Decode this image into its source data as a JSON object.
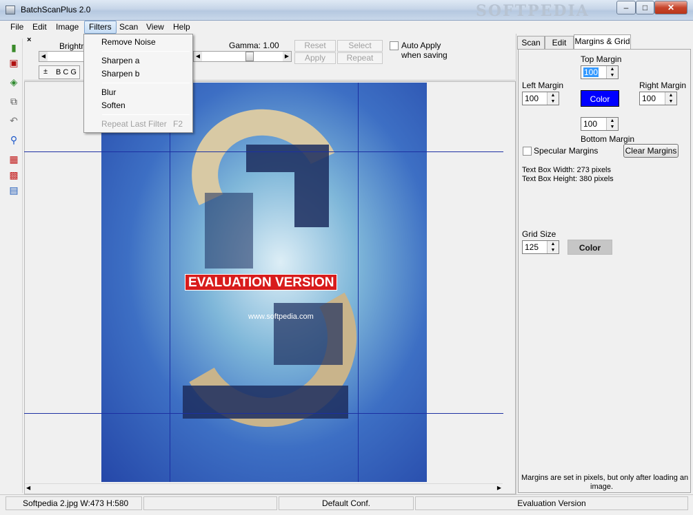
{
  "window": {
    "title": "BatchScanPlus 2.0",
    "watermark": "SOFTPEDIA",
    "minimize": "–",
    "maximize": "□",
    "close": "✕"
  },
  "menu": {
    "file": "File",
    "edit": "Edit",
    "image": "Image",
    "filters": "Filters",
    "scan": "Scan",
    "view": "View",
    "help": "Help"
  },
  "filters_menu": {
    "remove_noise": "Remove Noise",
    "sharpen_a": "Sharpen a",
    "sharpen_b": "Sharpen b",
    "blur": "Blur",
    "soften": "Soften",
    "repeat_last": "Repeat Last Filter",
    "repeat_shortcut": "F2"
  },
  "controls": {
    "close": "×",
    "brightness_label": "Brightn",
    "gamma_label": "Gamma: 1.00",
    "bcg_label": "B C G",
    "reset": "Reset",
    "select": "Select",
    "apply": "Apply",
    "repeat": "Repeat",
    "auto_apply_line1": "Auto Apply",
    "auto_apply_line2": "when saving"
  },
  "image": {
    "evaluation_overlay": "EVALUATION VERSION",
    "url_overlay": "www.softpedia.com"
  },
  "tabs": {
    "scan": "Scan",
    "edit": "Edit",
    "margins_grid": "Margins & Grid"
  },
  "margins": {
    "top_label": "Top Margin",
    "top_value": "100",
    "left_label": "Left Margin",
    "left_value": "100",
    "right_label": "Right Margin",
    "right_value": "100",
    "bottom_value": "100",
    "bottom_label": "Bottom Margin",
    "color_button": "Color",
    "specular_label": "Specular Margins",
    "clear_button": "Clear Margins",
    "text_box_width": "Text Box Width: 273 pixels",
    "text_box_height": "Text Box Height: 380 pixels",
    "grid_size_label": "Grid Size",
    "grid_size_value": "125",
    "grid_color_button": "Color",
    "note_line1": "Margins are set in pixels, but only after loading an",
    "note_line2": "image."
  },
  "status": {
    "file_info": "Softpedia 2.jpg W:473 H:580",
    "config": "Default Conf.",
    "version": "Evaluation Version"
  },
  "colors": {
    "grid_line": "#1c2fa2",
    "margin_color": "#0000ff",
    "eval_red": "#d81c1c"
  }
}
